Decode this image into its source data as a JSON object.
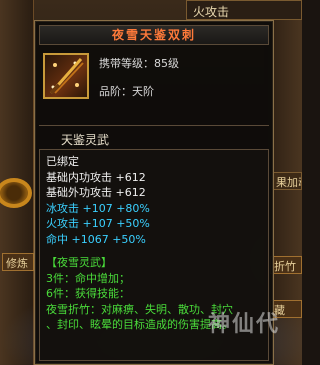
{
  "background": {
    "top_right_label": "火攻击",
    "right_combo_label": "果加动",
    "right_button_1": "折竹",
    "right_button_2": "藏",
    "left_button": "修炼"
  },
  "tooltip": {
    "title": "夜雪天鉴双刺",
    "required_level": "携带等级：85级",
    "grade": "品阶：天阶",
    "category": "天鉴灵武",
    "bound": "已绑定",
    "stats": [
      {
        "label": "基础内功攻击",
        "value": "+612"
      },
      {
        "label": "基础外功攻击",
        "value": "+612"
      },
      {
        "label": "冰攻击",
        "value": "+107",
        "extra": "+80%"
      },
      {
        "label": "火攻击",
        "value": "+107",
        "extra": "+50%"
      },
      {
        "label": "命中",
        "value": "+1067",
        "extra": "+50%"
      }
    ],
    "set": {
      "name": "【夜雪灵武】",
      "bonus_3": "3件：命中增加；",
      "bonus_6": "6件：获得技能：",
      "skill_line_1": "夜雪折竹：对麻痹、失明、散功、封穴",
      "skill_line_2": "、封印、眩晕的目标造成的伤害提高。"
    }
  },
  "watermark": "神仙代",
  "colors": {
    "title": "#ff7a3a",
    "stat_white": "#f0f0f0",
    "element_cyan": "#3ad0ff",
    "set_green": "#4adc3a",
    "border_gold": "#8a7048"
  }
}
